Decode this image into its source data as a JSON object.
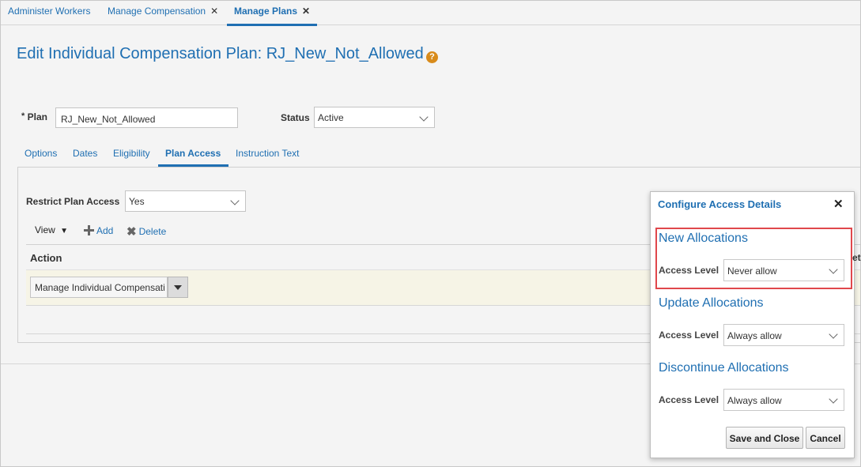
{
  "top_tabs": [
    {
      "label": "Administer Workers"
    },
    {
      "label": "Manage Compensation",
      "close": "✕"
    },
    {
      "label": "Manage Plans",
      "close": "✕"
    }
  ],
  "page": {
    "title": "Edit Individual Compensation Plan: RJ_New_Not_Allowed",
    "help": "?"
  },
  "form": {
    "required_mark": "*",
    "plan_label": "Plan",
    "plan_value": "RJ_New_Not_Allowed",
    "status_label": "Status",
    "status_value": "Active"
  },
  "sub_tabs": [
    "Options",
    "Dates",
    "Eligibility",
    "Plan Access",
    "Instruction Text"
  ],
  "plan_access": {
    "restrict_label": "Restrict Plan Access",
    "restrict_value": "Yes",
    "view_label": "View",
    "add_label": "Add",
    "delete_label": "Delete",
    "column_action": "Action",
    "column_partial": "et",
    "row_action_value": "Manage Individual Compensati"
  },
  "dialog": {
    "title": "Configure Access Details",
    "close": "✕",
    "sections": [
      {
        "title": "New Allocations",
        "label": "Access Level",
        "value": "Never allow"
      },
      {
        "title": "Update Allocations",
        "label": "Access Level",
        "value": "Always allow"
      },
      {
        "title": "Discontinue Allocations",
        "label": "Access Level",
        "value": "Always allow"
      }
    ],
    "save_close_label": "Save and Close",
    "cancel_label": "Cancel",
    "highlight_color": "#e0474c"
  },
  "colors": {
    "accent": "#1f6fb2",
    "help_icon": "#d88b1b",
    "row_highlight": "#f6f4e6"
  }
}
